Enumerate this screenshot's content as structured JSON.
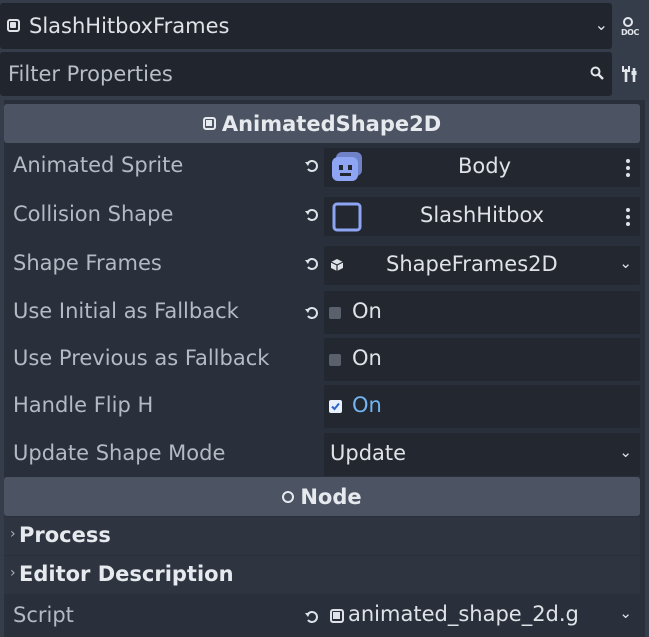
{
  "header": {
    "node_name": "SlashHitboxFrames"
  },
  "filter": {
    "placeholder": "Filter Properties"
  },
  "sections": {
    "animated_shape": {
      "title": "AnimatedShape2D",
      "properties": {
        "animated_sprite": {
          "label": "Animated Sprite",
          "value": "Body"
        },
        "collision_shape": {
          "label": "Collision Shape",
          "value": "SlashHitbox"
        },
        "shape_frames": {
          "label": "Shape Frames",
          "value": "ShapeFrames2D"
        },
        "use_initial": {
          "label": "Use Initial as Fallback",
          "value": "On",
          "checked": false
        },
        "use_previous": {
          "label": "Use Previous as Fallback",
          "value": "On",
          "checked": false
        },
        "handle_flip_h": {
          "label": "Handle Flip H",
          "value": "On",
          "checked": true
        },
        "update_shape_mode": {
          "label": "Update Shape Mode",
          "value": "Update"
        }
      }
    },
    "node": {
      "title": "Node",
      "groups": {
        "process": "Process",
        "editor_description": "Editor Description"
      },
      "script": {
        "label": "Script",
        "value": "animated_shape_2d.g"
      }
    }
  },
  "colors": {
    "panel_bg": "#2a303b",
    "section_header": "#4c5463",
    "checkbox_on_text": "#73b5f1",
    "sprite_icon": "#8da5f3"
  },
  "icons": {
    "node": "node-icon",
    "doc": "doc-icon",
    "search": "search-icon",
    "tools": "tools-icon",
    "revert": "revert-icon",
    "kebab": "kebab-menu-icon",
    "chevron": "chevron-down-icon",
    "resource": "resource-cube-icon",
    "script": "script-icon"
  }
}
